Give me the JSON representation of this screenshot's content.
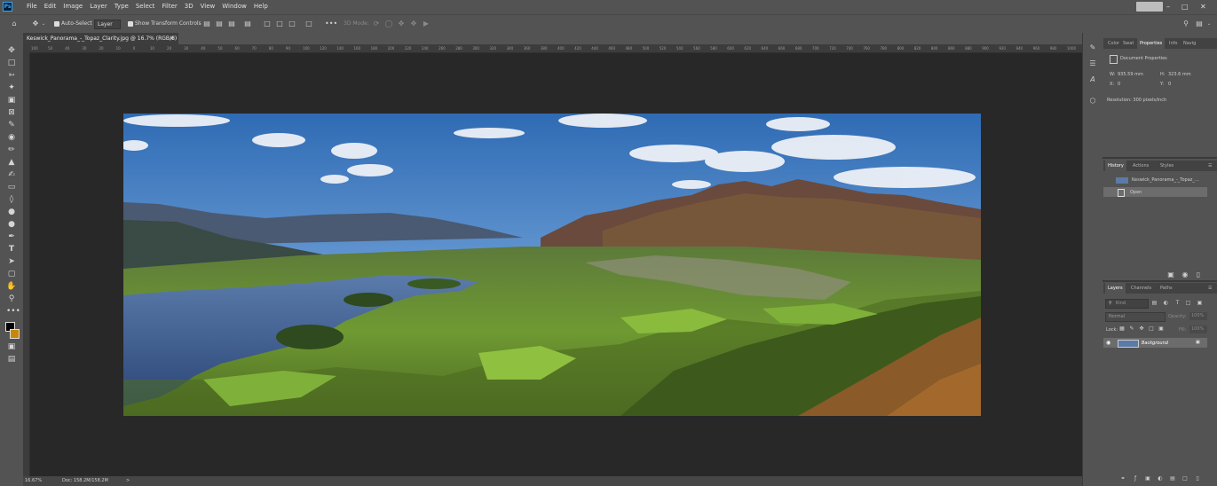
{
  "menubar": {
    "items": [
      "File",
      "Edit",
      "Image",
      "Layer",
      "Type",
      "Select",
      "Filter",
      "3D",
      "View",
      "Window",
      "Help"
    ]
  },
  "options": {
    "auto_select_label": "Auto-Select",
    "auto_select_value": "Layer",
    "show_transform_label": "Show Transform Controls",
    "mode_label": "3D Mode:"
  },
  "document": {
    "tab_title": "Keswick_Panorama_-_Topaz_Clarity.jpg @ 16.7% (RGB/8)",
    "close_symbol": "×"
  },
  "ruler": {
    "ticks": [
      "100",
      "50",
      "40",
      "30",
      "20",
      "10",
      "0",
      "10",
      "20",
      "30",
      "40",
      "50",
      "60",
      "70",
      "80",
      "90",
      "100",
      "120",
      "140",
      "160",
      "180",
      "200",
      "220",
      "240",
      "260",
      "280",
      "300",
      "320",
      "340",
      "360",
      "380",
      "400",
      "420",
      "440",
      "460",
      "480",
      "500",
      "520",
      "540",
      "560",
      "580",
      "600",
      "620",
      "640",
      "660",
      "680",
      "700",
      "720",
      "740",
      "760",
      "780",
      "800",
      "820",
      "840",
      "860",
      "880",
      "900",
      "920",
      "940",
      "960",
      "980",
      "1000"
    ]
  },
  "status": {
    "zoom": "16.67%",
    "doc_size": "Doc: 158.2M/158.2M",
    "arrow": ">"
  },
  "properties_panel": {
    "tabs": [
      "Color",
      "Swat",
      "Properties",
      "Info",
      "Navig"
    ],
    "active_tab": "Properties",
    "section": "Document Properties",
    "w_label": "W:",
    "w_value": "935.59 mm",
    "h_label": "H:",
    "h_value": "323.6 mm",
    "x_label": "X:",
    "x_value": "0",
    "y_label": "Y:",
    "y_value": "0",
    "resolution": "Resolution: 300 pixels/inch"
  },
  "history_panel": {
    "tabs": [
      "History",
      "Actions",
      "Styles"
    ],
    "active_tab": "History",
    "snapshot": "Keswick_Panorama_-_Topaz_...",
    "step": "Open"
  },
  "layers_panel": {
    "tabs": [
      "Layers",
      "Channels",
      "Paths"
    ],
    "active_tab": "Layers",
    "kind_placeholder": "Kind",
    "blend_mode": "Normal",
    "opacity_label": "Opacity:",
    "opacity_value": "100%",
    "lock_label": "Lock:",
    "fill_label": "Fill:",
    "fill_value": "100%",
    "layer_name": "Background"
  },
  "colors": {
    "app_bg": "#535353",
    "canvas_bg": "#282828",
    "accent_blue": "#31a8ff",
    "selected_row": "#6c6c6c"
  }
}
